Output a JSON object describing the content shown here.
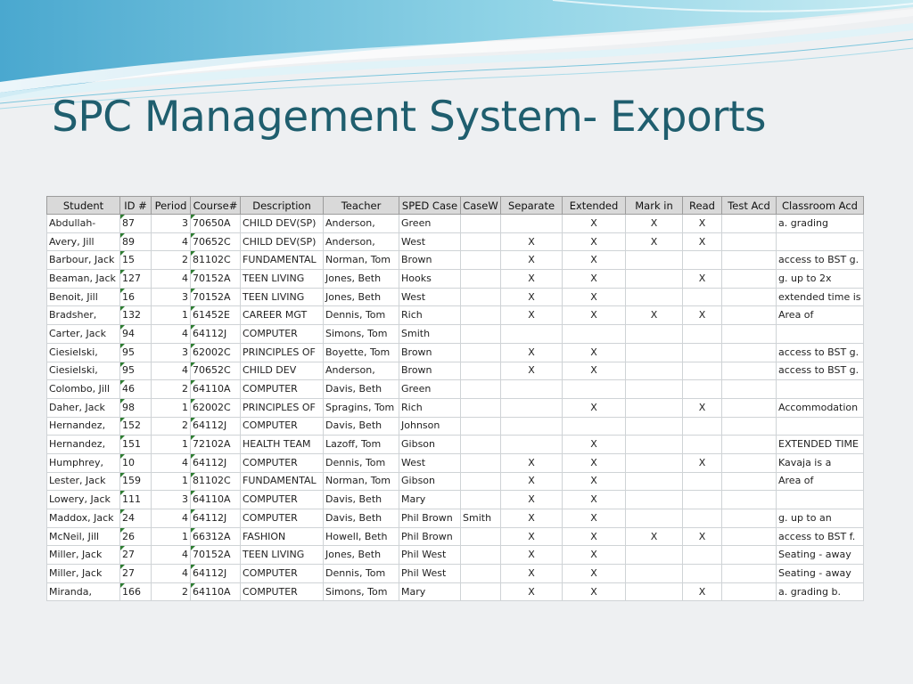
{
  "slide": {
    "title": "SPC Management System- Exports"
  },
  "table": {
    "headers": [
      "Student",
      "ID #",
      "Period",
      "Course#",
      "Description",
      "Teacher",
      "SPED Case",
      "CaseW",
      "Separate",
      "Extended",
      "Mark in",
      "Read",
      "Test Acd",
      "Classroom Acd"
    ],
    "rows": [
      [
        "Abdullah-",
        "87",
        "3",
        "70650A",
        "CHILD DEV(SP)",
        "Anderson,",
        "Green",
        "",
        "",
        "X",
        "X",
        "X",
        "",
        "a. grading"
      ],
      [
        "Avery, Jill",
        "89",
        "4",
        "70652C",
        "CHILD DEV(SP)",
        "Anderson,",
        "West",
        "",
        "X",
        "X",
        "X",
        "X",
        "",
        ""
      ],
      [
        "Barbour, Jack",
        "15",
        "2",
        "81102C",
        "FUNDAMENTAL",
        "Norman, Tom",
        "Brown",
        "",
        "X",
        "X",
        "",
        "",
        "",
        "access to BST g."
      ],
      [
        "Beaman, Jack",
        "127",
        "4",
        "70152A",
        "TEEN LIVING",
        "Jones, Beth",
        "Hooks",
        "",
        "X",
        "X",
        "",
        "X",
        "",
        "g. up to 2x"
      ],
      [
        "Benoit, Jill",
        "16",
        "3",
        "70152A",
        "TEEN LIVING",
        "Jones, Beth",
        "West",
        "",
        "X",
        "X",
        "",
        "",
        "",
        "extended time is"
      ],
      [
        "Bradsher,",
        "132",
        "1",
        "61452E",
        "CAREER MGT",
        "Dennis, Tom",
        "Rich",
        "",
        "X",
        "X",
        "X",
        "X",
        "",
        "Area of"
      ],
      [
        "Carter, Jack",
        "94",
        "4",
        "64112J",
        "COMPUTER",
        "Simons, Tom",
        "Smith",
        "",
        "",
        "",
        "",
        "",
        "",
        ""
      ],
      [
        "Ciesielski,",
        "95",
        "3",
        "62002C",
        "PRINCIPLES OF",
        "Boyette, Tom",
        "Brown",
        "",
        "X",
        "X",
        "",
        "",
        "",
        "access to BST g."
      ],
      [
        "Ciesielski,",
        "95",
        "4",
        "70652C",
        "CHILD DEV",
        "Anderson,",
        "Brown",
        "",
        "X",
        "X",
        "",
        "",
        "",
        "access to BST g."
      ],
      [
        "Colombo, Jill",
        "46",
        "2",
        "64110A",
        "COMPUTER",
        "Davis, Beth",
        "Green",
        "",
        "",
        "",
        "",
        "",
        "",
        ""
      ],
      [
        "Daher, Jack",
        "98",
        "1",
        "62002C",
        "PRINCIPLES OF",
        "Spragins, Tom",
        "Rich",
        "",
        "",
        "X",
        "",
        "X",
        "",
        "Accommodation"
      ],
      [
        "Hernandez,",
        "152",
        "2",
        "64112J",
        "COMPUTER",
        "Davis, Beth",
        "Johnson",
        "",
        "",
        "",
        "",
        "",
        "",
        ""
      ],
      [
        "Hernandez,",
        "151",
        "1",
        "72102A",
        "HEALTH TEAM",
        "Lazoff, Tom",
        "Gibson",
        "",
        "",
        "X",
        "",
        "",
        "",
        "EXTENDED TIME"
      ],
      [
        "Humphrey,",
        "10",
        "4",
        "64112J",
        "COMPUTER",
        "Dennis, Tom",
        "West",
        "",
        "X",
        "X",
        "",
        "X",
        "",
        "Kavaja is a"
      ],
      [
        "Lester, Jack",
        "159",
        "1",
        "81102C",
        "FUNDAMENTAL",
        "Norman, Tom",
        "Gibson",
        "",
        "X",
        "X",
        "",
        "",
        "",
        "Area of"
      ],
      [
        "Lowery, Jack",
        "111",
        "3",
        "64110A",
        "COMPUTER",
        "Davis, Beth",
        "Mary",
        "",
        "X",
        "X",
        "",
        "",
        "",
        ""
      ],
      [
        "Maddox, Jack",
        "24",
        "4",
        "64112J",
        "COMPUTER",
        "Davis, Beth",
        "Phil Brown",
        "Smith",
        "X",
        "X",
        "",
        "",
        "",
        "g. up to an"
      ],
      [
        "McNeil, Jill",
        "26",
        "1",
        "66312A",
        "FASHION",
        "Howell, Beth",
        "Phil Brown",
        "",
        "X",
        "X",
        "X",
        "X",
        "",
        "access to BST f."
      ],
      [
        "Miller, Jack",
        "27",
        "4",
        "70152A",
        "TEEN LIVING",
        "Jones, Beth",
        "Phil West",
        "",
        "X",
        "X",
        "",
        "",
        "",
        "Seating - away"
      ],
      [
        "Miller, Jack",
        "27",
        "4",
        "64112J",
        "COMPUTER",
        "Dennis, Tom",
        "Phil West",
        "",
        "X",
        "X",
        "",
        "",
        "",
        "Seating - away"
      ],
      [
        "Miranda,",
        "166",
        "2",
        "64110A",
        "COMPUTER",
        "Simons, Tom",
        "Mary",
        "",
        "X",
        "X",
        "",
        "X",
        "",
        "a. grading b."
      ]
    ]
  },
  "colors": {
    "title": "#1f5e6e",
    "header_bg": "#d9d9d9",
    "wave": "#6cc0dc",
    "cell_marker": "#2e7d32"
  }
}
